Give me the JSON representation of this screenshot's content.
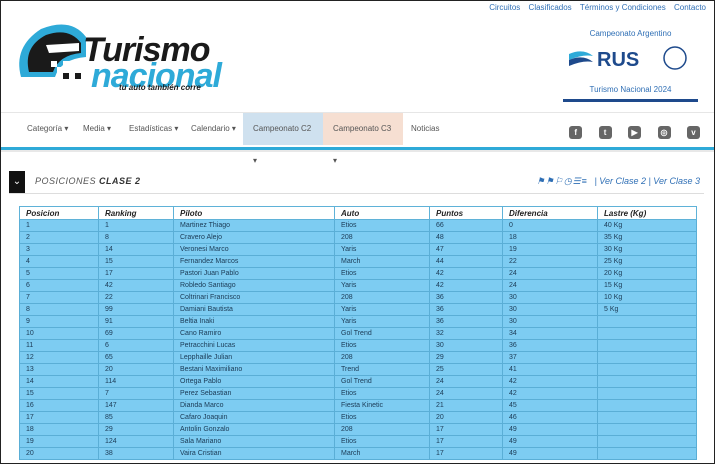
{
  "toplinks": [
    "Circuitos",
    "Clasificados",
    "Términos y Condiciones",
    "Contacto"
  ],
  "logo": {
    "line1": "Turismo",
    "line2": "nacional",
    "tagline": "tu auto también corre"
  },
  "sponsor": {
    "line1": "Campeonato Argentino",
    "brand": "RUS",
    "line2": "Turismo Nacional 2024"
  },
  "nav": [
    {
      "label": "Categoría ▾"
    },
    {
      "label": "Media ▾"
    },
    {
      "label": "Estadísticas ▾"
    },
    {
      "label": "Calendario ▾"
    },
    {
      "label": "Campeonato C2 ▾"
    },
    {
      "label": "Campeonato C3 ▾"
    },
    {
      "label": "Noticias"
    }
  ],
  "social": [
    "f",
    "t",
    "▶",
    "◎",
    "v"
  ],
  "section": {
    "prefix": "POSICIONES",
    "clase": "CLASE 2",
    "links": "| Ver Clase 2 | Ver Clase 3"
  },
  "table": {
    "headers": [
      "Posicion",
      "Ranking",
      "Piloto",
      "Auto",
      "Puntos",
      "Diferencia",
      "Lastre (Kg)"
    ],
    "rows": [
      [
        "1",
        "1",
        "Martinez Thiago",
        "Etios",
        "66",
        "0",
        "40 Kg"
      ],
      [
        "2",
        "8",
        "Cravero Alejo",
        "208",
        "48",
        "18",
        "35 Kg"
      ],
      [
        "3",
        "14",
        "Veronesi Marco",
        "Yaris",
        "47",
        "19",
        "30 Kg"
      ],
      [
        "4",
        "15",
        "Fernandez Marcos",
        "March",
        "44",
        "22",
        "25 Kg"
      ],
      [
        "5",
        "17",
        "Pastori Juan Pablo",
        "Etios",
        "42",
        "24",
        "20 Kg"
      ],
      [
        "6",
        "42",
        "Robledo Santiago",
        "Yaris",
        "42",
        "24",
        "15 Kg"
      ],
      [
        "7",
        "22",
        "Coltrinari Francisco",
        "208",
        "36",
        "30",
        "10 Kg"
      ],
      [
        "8",
        "99",
        "Damiani Bautista",
        "Yaris",
        "36",
        "30",
        "5 Kg"
      ],
      [
        "9",
        "91",
        "Beltia Inaki",
        "Yaris",
        "36",
        "30",
        ""
      ],
      [
        "10",
        "69",
        "Cano Ramiro",
        "Gol Trend",
        "32",
        "34",
        ""
      ],
      [
        "11",
        "6",
        "Petracchini Lucas",
        "Etios",
        "30",
        "36",
        ""
      ],
      [
        "12",
        "65",
        "Lepphaille Julian",
        "208",
        "29",
        "37",
        ""
      ],
      [
        "13",
        "20",
        "Bestani Maximiliano",
        "Trend",
        "25",
        "41",
        ""
      ],
      [
        "14",
        "114",
        "Ortega Pablo",
        "Gol Trend",
        "24",
        "42",
        ""
      ],
      [
        "15",
        "7",
        "Perez Sebastian",
        "Etios",
        "24",
        "42",
        ""
      ],
      [
        "16",
        "147",
        "Dianda Marco",
        "Fiesta Kinetic",
        "21",
        "45",
        ""
      ],
      [
        "17",
        "85",
        "Cafaro Joaquin",
        "Etios",
        "20",
        "46",
        ""
      ],
      [
        "18",
        "29",
        "Antolin Gonzalo",
        "208",
        "17",
        "49",
        ""
      ],
      [
        "19",
        "124",
        "Sala Mariano",
        "Etios",
        "17",
        "49",
        ""
      ],
      [
        "20",
        "38",
        "Vaira Cristian",
        "March",
        "17",
        "49",
        ""
      ]
    ]
  }
}
